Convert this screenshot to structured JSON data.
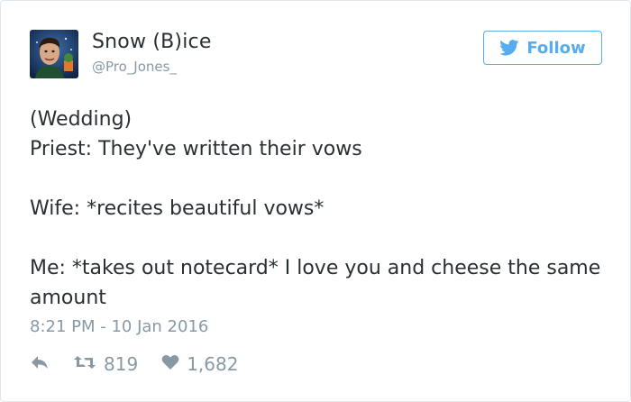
{
  "author": {
    "display_name": "Snow (B)ice",
    "handle": "@Pro_Jones_",
    "avatar_icon": "profile-photo"
  },
  "follow_button": {
    "label": "Follow",
    "icon": "twitter-bird-icon",
    "color": "#55acee"
  },
  "tweet": {
    "lines": [
      "(Wedding)",
      "Priest: They've written their vows",
      "Wife: *recites beautiful vows*",
      "Me: *takes out notecard* I love you and cheese the same amount"
    ],
    "timestamp": "8:21 PM - 10 Jan 2016"
  },
  "actions": {
    "reply_icon": "reply-arrow-icon",
    "retweet_icon": "retweet-icon",
    "retweet_count": "819",
    "like_icon": "heart-icon",
    "like_count": "1,682"
  },
  "colors": {
    "text": "#292f33",
    "muted": "#8899a6",
    "accent": "#55acee",
    "border": "#e1e8ed"
  }
}
